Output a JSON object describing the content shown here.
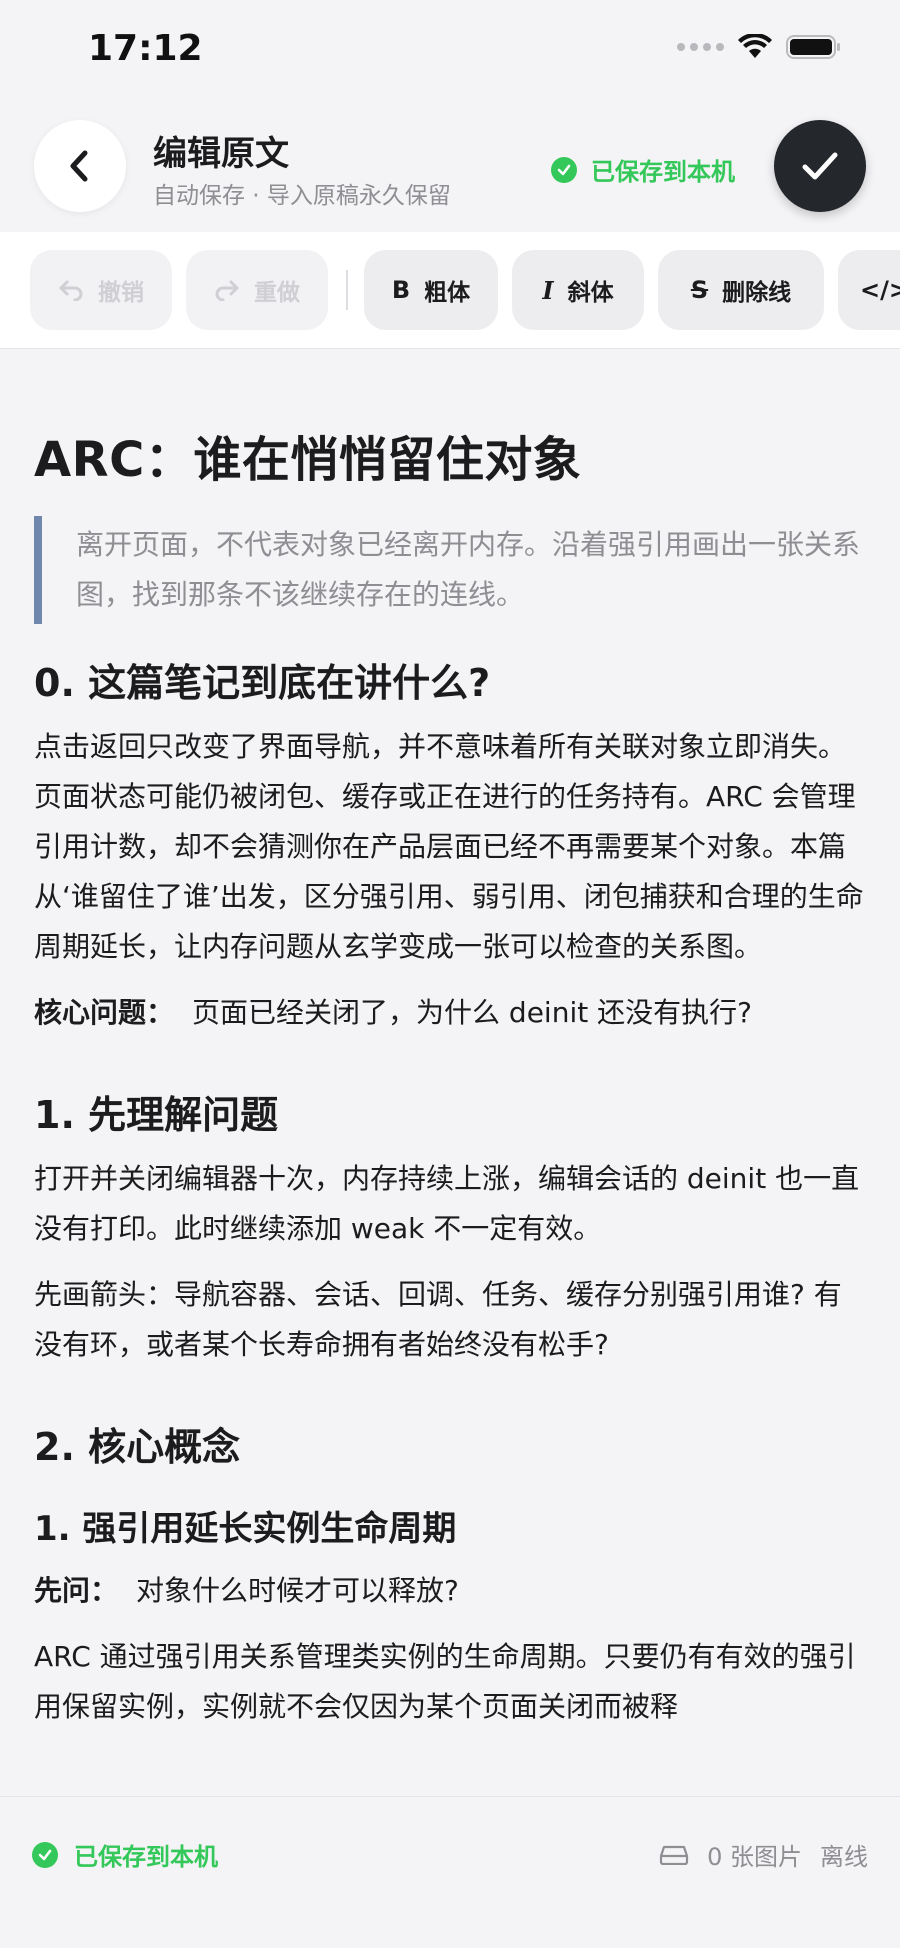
{
  "status_bar": {
    "time": "17:12"
  },
  "header": {
    "title": "编辑原文",
    "subtitle": "自动保存 · 导入原稿永久保留",
    "save_status": "已保存到本机"
  },
  "toolbar": {
    "undo": "撤销",
    "redo": "重做",
    "bold": "粗体",
    "italic": "斜体",
    "strikethrough": "删除线"
  },
  "doc": {
    "title": "ARC：谁在悄悄留住对象",
    "quote": "离开页面，不代表对象已经离开内存。沿着强引用画出一张关系图，找到那条不该继续存在的连线。",
    "s0": {
      "heading": "0. 这篇笔记到底在讲什么?",
      "para": "点击返回只改变了界面导航，并不意味着所有关联对象立即消失。页面状态可能仍被闭包、缓存或正在进行的任务持有。ARC 会管理引用计数，却不会猜测你在产品层面已经不再需要某个对象。本篇从‘谁留住了谁’出发，区分强引用、弱引用、闭包捕获和合理的生命周期延长，让内存问题从玄学变成一张可以检查的关系图。",
      "lead_label": "核心问题：",
      "lead_text": "页面已经关闭了，为什么 deinit 还没有执行?"
    },
    "s1": {
      "heading": "1. 先理解问题",
      "para1": "打开并关闭编辑器十次，内存持续上涨，编辑会话的 deinit 也一直没有打印。此时继续添加 weak 不一定有效。",
      "para2": "先画箭头：导航容器、会话、回调、任务、缓存分别强引用谁? 有没有环，或者某个长寿命拥有者始终没有松手?"
    },
    "s2": {
      "heading": "2. 核心概念",
      "sub1": "1. 强引用延长实例生命周期",
      "lead_label": "先问：",
      "lead_text": "对象什么时候才可以释放?",
      "para": "ARC 通过强引用关系管理类实例的生命周期。只要仍有有效的强引用保留实例，实例就不会仅因为某个页面关闭而被释"
    }
  },
  "footer": {
    "save_status": "已保存到本机",
    "image_count": "0 张图片",
    "network": "离线"
  }
}
